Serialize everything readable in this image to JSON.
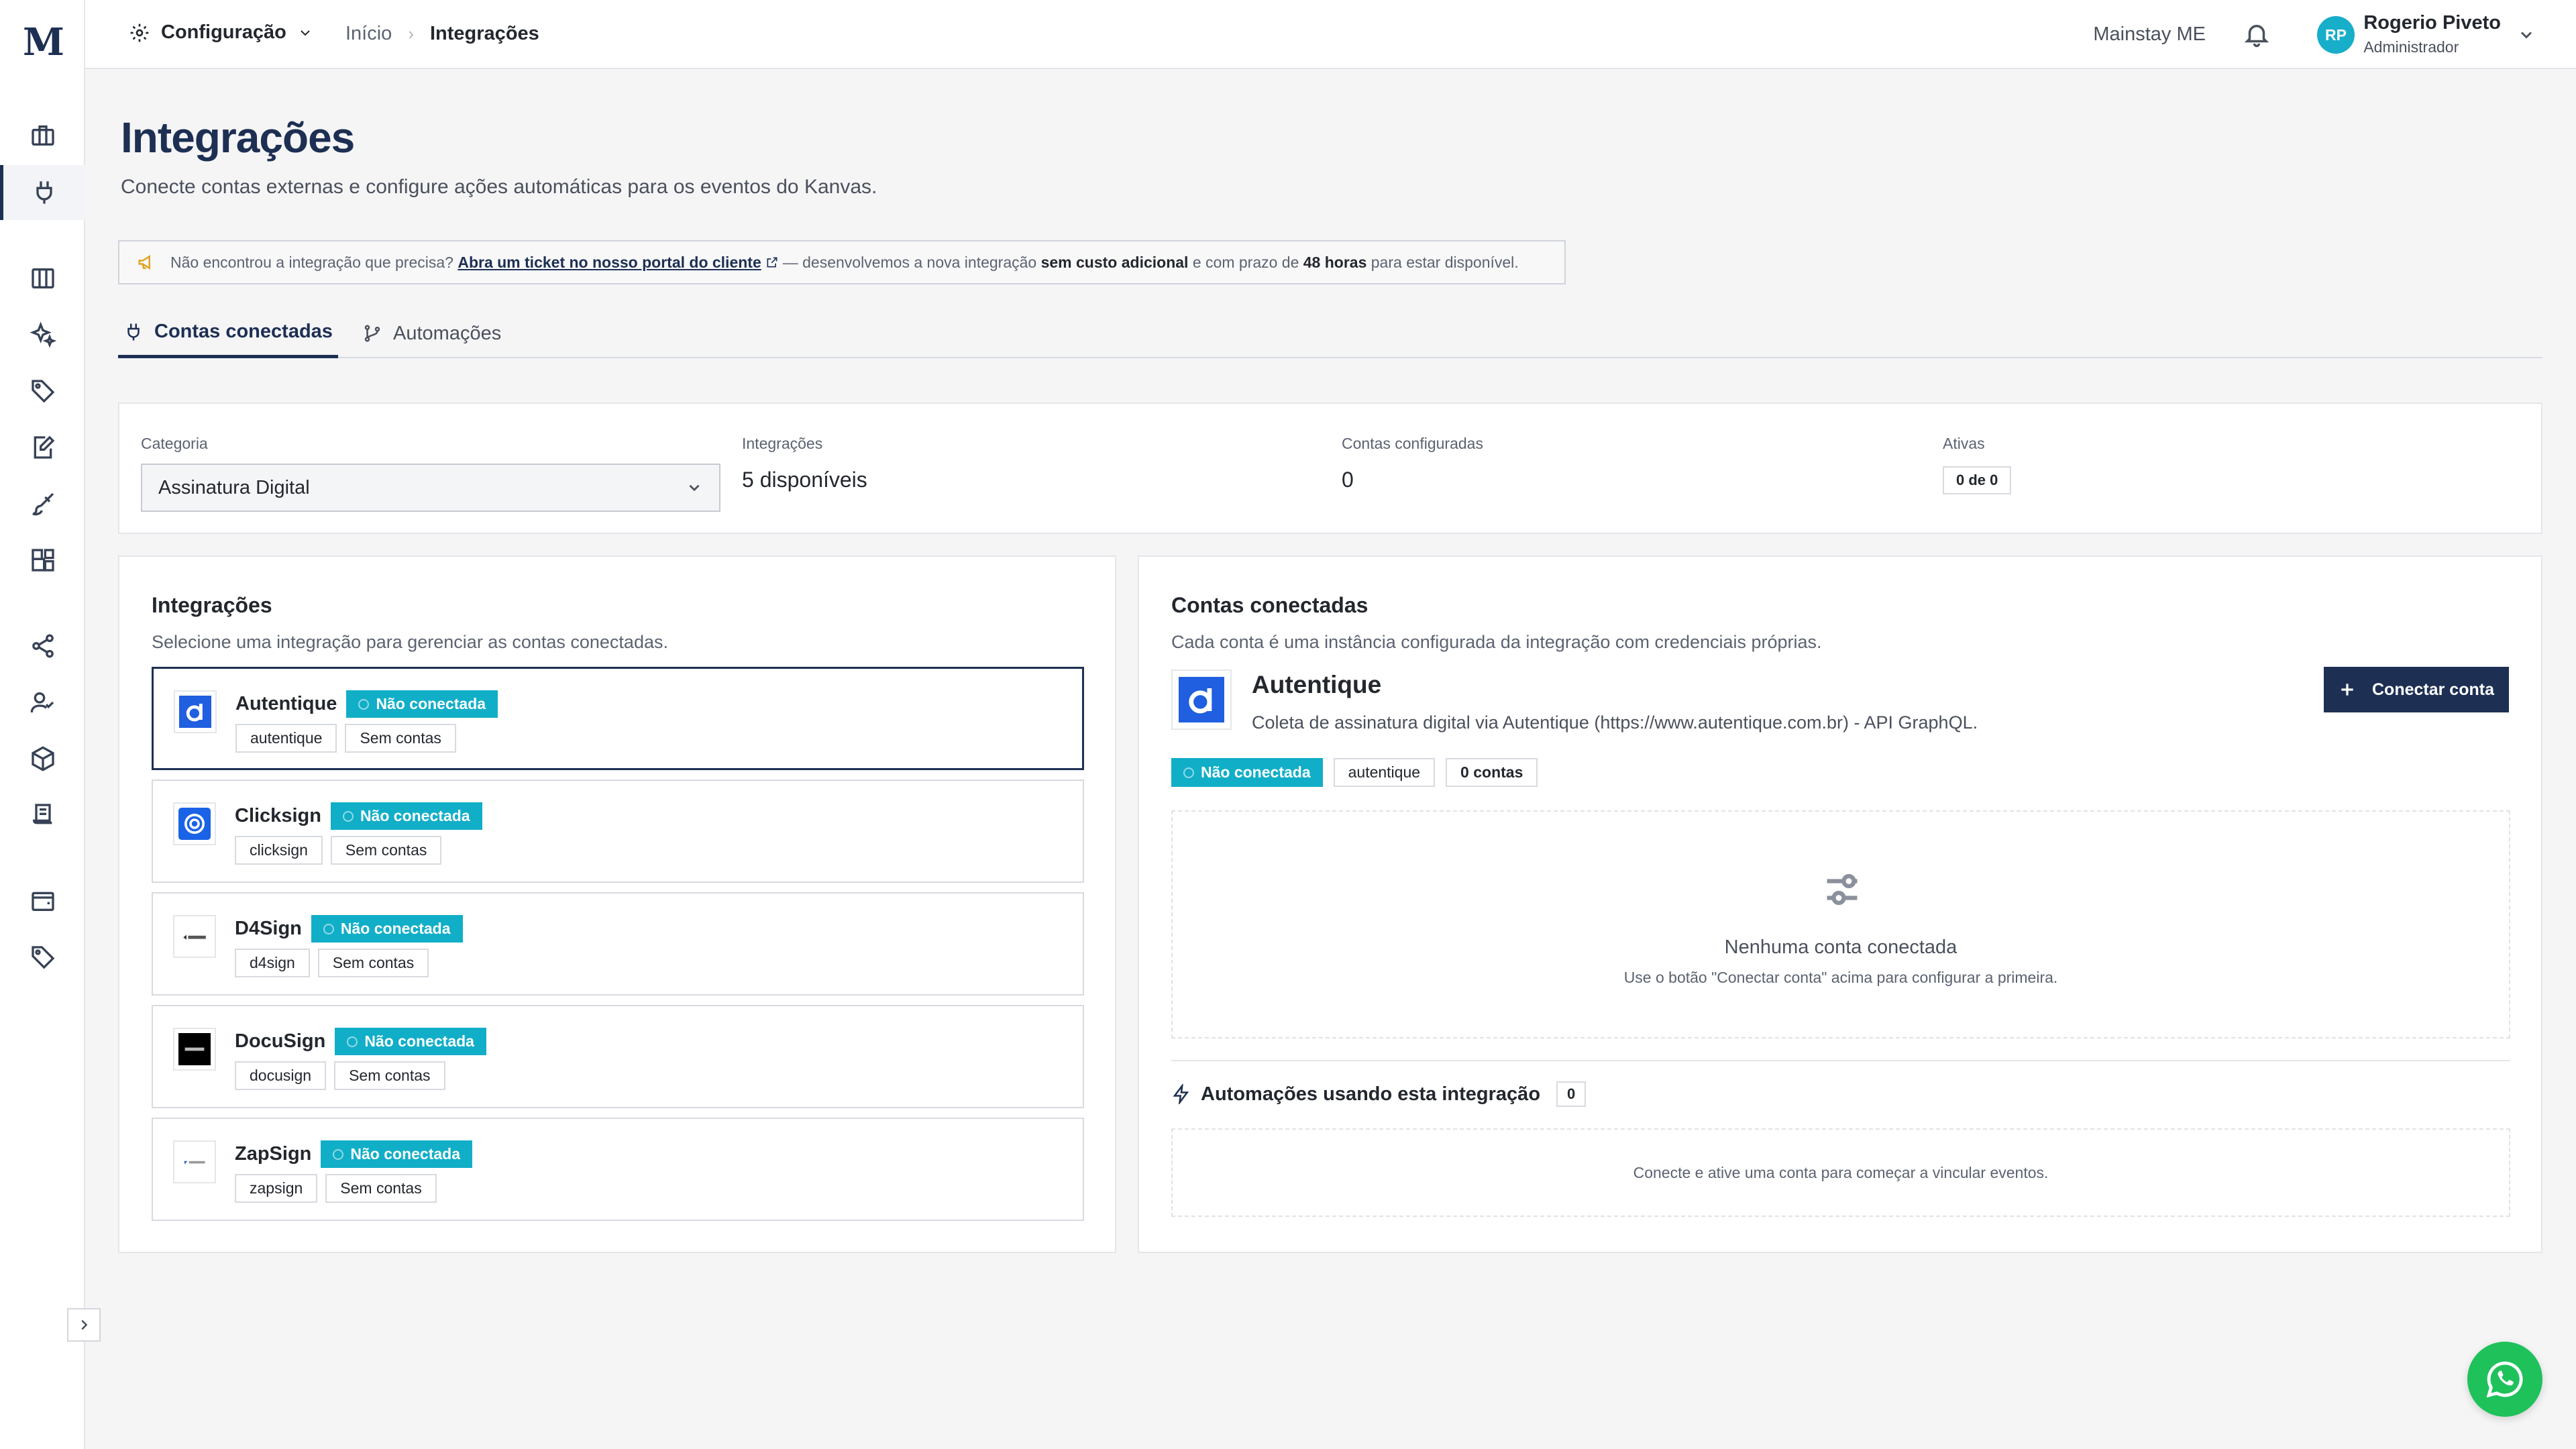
{
  "app": {
    "logo": "M"
  },
  "sidebar": {
    "icons": [
      "briefcase-icon",
      "plug-icon",
      "columns-icon",
      "sparkles-icon",
      "tag-icon",
      "edit-document-icon",
      "brush-icon",
      "apps-icon",
      "share-icon",
      "user-check-icon",
      "box-icon",
      "receipt-icon",
      "wallet-icon",
      "tag-icon"
    ]
  },
  "header": {
    "section_label": "Configuração",
    "breadcrumb": [
      "Início",
      "Integrações"
    ],
    "company": "Mainstay ME",
    "user_initials": "RP",
    "user_name": "Rogerio Piveto",
    "user_role": "Administrador"
  },
  "page": {
    "title": "Integrações",
    "subtitle": "Conecte contas externas e configure ações automáticas para os eventos do Kanvas."
  },
  "banner": {
    "text1": "Não encontrou a integração que precisa?",
    "link": "Abra um ticket no nosso portal do cliente",
    "text2": "— desenvolvemos a nova integração",
    "bold1": "sem custo adicional",
    "text3": "e com prazo de",
    "bold2": "48 horas",
    "text4": "para estar disponível."
  },
  "tabs": [
    {
      "label": "Contas conectadas",
      "active": true
    },
    {
      "label": "Automações",
      "active": false
    }
  ],
  "stats": {
    "category_label": "Categoria",
    "category_value": "Assinatura Digital",
    "integrations_label": "Integrações",
    "integrations_value": "5 disponíveis",
    "accounts_label": "Contas configuradas",
    "accounts_value": "0",
    "active_label": "Ativas",
    "active_value": "0 de 0"
  },
  "integrations_panel": {
    "title": "Integrações",
    "description": "Selecione uma integração para gerenciar as contas conectadas.",
    "items": [
      {
        "name": "Autentique",
        "status": "Não conectada",
        "slug": "autentique",
        "accounts": "Sem contas",
        "logo_color": "#1f5fe0"
      },
      {
        "name": "Clicksign",
        "status": "Não conectada",
        "slug": "clicksign",
        "accounts": "Sem contas",
        "logo_color": "#1a63e6"
      },
      {
        "name": "D4Sign",
        "status": "Não conectada",
        "slug": "d4sign",
        "accounts": "Sem contas",
        "logo_color": "#333333"
      },
      {
        "name": "DocuSign",
        "status": "Não conectada",
        "slug": "docusign",
        "accounts": "Sem contas",
        "logo_color": "#000000"
      },
      {
        "name": "ZapSign",
        "status": "Não conectada",
        "slug": "zapsign",
        "accounts": "Sem contas",
        "logo_color": "#2c5fd6"
      }
    ]
  },
  "accounts_panel": {
    "title": "Contas conectadas",
    "description": "Cada conta é uma instância configurada da integração com credenciais próprias.",
    "selected_name": "Autentique",
    "selected_description": "Coleta de assinatura digital via Autentique (https://www.autentique.com.br) - API GraphQL.",
    "connect_button": "Conectar conta",
    "status": "Não conectada",
    "slug": "autentique",
    "accounts_count": "0 contas",
    "empty_title": "Nenhuma conta conectada",
    "empty_hint": "Use o botão \"Conectar conta\" acima para configurar a primeira.",
    "automations_title": "Automações usando esta integração",
    "automations_count": "0",
    "automations_hint": "Conecte e ative uma conta para começar a vincular eventos."
  },
  "colors": {
    "primary": "#1d2f53",
    "status_badge": "#11aec8",
    "avatar": "#17aeca",
    "whatsapp": "#1fc15b"
  }
}
